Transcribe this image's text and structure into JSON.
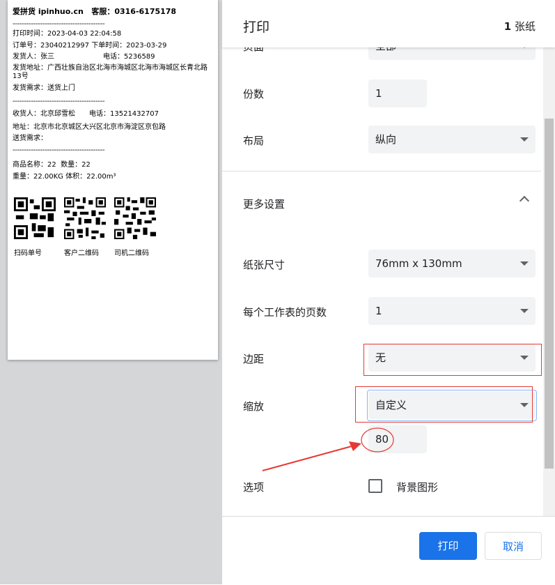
{
  "receipt": {
    "brand": "爱拼货 ipinhuo.cn",
    "service": "客服：0316-6175178",
    "dash": "----------------------------------------",
    "print_time": "打印时间：2023-04-03 22:04:58",
    "order_no": "订单号：23040212997",
    "order_time": "下单时间：2023-03-29",
    "sender": "发货人：张三",
    "sender_phone": "电话：5236589",
    "sender_addr_1": "发货地址：广西壮族自治区北海市海城区北海市海城区长青北路",
    "sender_addr_2": "13号",
    "ship_req": "发货需求：送货上门",
    "receiver": "收货人：北京邱雪松",
    "receiver_phone": "电话：13521432707",
    "receiver_addr": "地址：北京市北京城区大兴区北京市海淀区京包路",
    "deliver_req": "送货需求：",
    "goods_name": "商品名称：22",
    "quantity": "数量：22",
    "weight": "重量：22.00KG",
    "volume": "体积：22.00m³",
    "qr_labels": [
      "扫码单号",
      "客户二维码",
      "司机二维码"
    ]
  },
  "header": {
    "title": "打印",
    "sheet_count": "1",
    "sheet_unit": "张纸"
  },
  "settings": {
    "pages": {
      "label": "页面",
      "value": "全部"
    },
    "copies": {
      "label": "份数",
      "value": "1"
    },
    "layout": {
      "label": "布局",
      "value": "纵向"
    },
    "more": {
      "label": "更多设置"
    },
    "paper_size": {
      "label": "纸张尺寸",
      "value": "76mm x 130mm"
    },
    "pages_per_sheet": {
      "label": "每个工作表的页数",
      "value": "1"
    },
    "margins": {
      "label": "边距",
      "value": "无"
    },
    "scale": {
      "label": "缩放",
      "value": "自定义",
      "custom_value": "80"
    },
    "options": {
      "label": "选项",
      "checkbox_label": "背景图形"
    }
  },
  "buttons": {
    "print": "打印",
    "cancel": "取消"
  },
  "colors": {
    "accent": "#1a73e8",
    "annotation": "#e53935"
  }
}
